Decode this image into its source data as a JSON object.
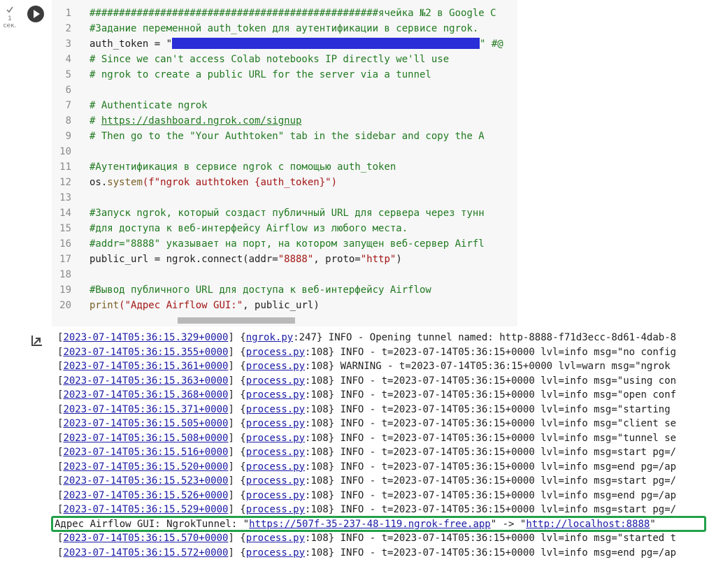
{
  "cell": {
    "exec_count": "1",
    "exec_unit": "сек.",
    "lines": [
      {
        "n": "1",
        "segments": [
          {
            "t": "#################################################ячейка №2 в Google C",
            "c": "comment"
          }
        ]
      },
      {
        "n": "2",
        "segments": [
          {
            "t": "#Задание переменной auth_token для аутентификации в сервисе ngrok.",
            "c": "comment"
          }
        ]
      },
      {
        "n": "3",
        "segments": [
          {
            "t": "auth_token = \"",
            "c": "plain"
          },
          {
            "t": "",
            "c": "redact"
          },
          {
            "t": "\" #@",
            "c": "comment"
          }
        ]
      },
      {
        "n": "4",
        "segments": [
          {
            "t": "# Since we can't access Colab notebooks IP directly we'll use",
            "c": "comment"
          }
        ]
      },
      {
        "n": "5",
        "segments": [
          {
            "t": "# ngrok to create a public URL for the server via a tunnel",
            "c": "comment"
          }
        ]
      },
      {
        "n": "6",
        "segments": []
      },
      {
        "n": "7",
        "segments": [
          {
            "t": "# Authenticate ngrok",
            "c": "comment"
          }
        ]
      },
      {
        "n": "8",
        "segments": [
          {
            "t": "# ",
            "c": "comment"
          },
          {
            "t": "https://dashboard.ngrok.com/signup",
            "c": "link"
          }
        ]
      },
      {
        "n": "9",
        "segments": [
          {
            "t": "# Then go to the \"Your Authtoken\" tab in the sidebar and copy the A",
            "c": "comment"
          }
        ]
      },
      {
        "n": "10",
        "segments": []
      },
      {
        "n": "11",
        "segments": [
          {
            "t": "#Аутентификация в сервисе ngrok с помощью auth_token",
            "c": "comment"
          }
        ]
      },
      {
        "n": "12",
        "segments": [
          {
            "t": "os.",
            "c": "plain"
          },
          {
            "t": "system",
            "c": "func"
          },
          {
            "t": "(f\"ngrok authtoken {auth_token}\")",
            "c": "str"
          }
        ]
      },
      {
        "n": "13",
        "segments": []
      },
      {
        "n": "14",
        "segments": [
          {
            "t": "#Запуск ngrok, который создаст публичный URL для сервера через тунн",
            "c": "comment"
          }
        ]
      },
      {
        "n": "15",
        "segments": [
          {
            "t": "#для доступа к веб-интерфейсу Airflow из любого места.",
            "c": "comment"
          }
        ]
      },
      {
        "n": "16",
        "segments": [
          {
            "t": "#addr=\"8888\" указывает на порт, на котором запущен веб-сервер Airfl",
            "c": "comment"
          }
        ]
      },
      {
        "n": "17",
        "segments": [
          {
            "t": "public_url = ngrok.connect(addr=",
            "c": "plain"
          },
          {
            "t": "\"8888\"",
            "c": "str"
          },
          {
            "t": ", proto=",
            "c": "plain"
          },
          {
            "t": "\"http\"",
            "c": "str"
          },
          {
            "t": ")",
            "c": "plain"
          }
        ]
      },
      {
        "n": "18",
        "segments": []
      },
      {
        "n": "19",
        "segments": [
          {
            "t": "#Вывод публичного URL для доступа к веб-интерфейсу Airflow",
            "c": "comment"
          }
        ]
      },
      {
        "n": "20",
        "segments": [
          {
            "t": "print",
            "c": "func"
          },
          {
            "t": "(\"Адрес Airflow GUI:\"",
            "c": "str"
          },
          {
            "t": ", public_url)",
            "c": "plain"
          }
        ]
      }
    ]
  },
  "output": {
    "lines": [
      {
        "ts": "2023-07-14T05:36:15.329+0000",
        "proc": "ngrok.py",
        "procnum": ":247",
        "rest": " INFO - Opening tunnel named: http-8888-f71d3ecc-8d61-4dab-8"
      },
      {
        "ts": "2023-07-14T05:36:15.355+0000",
        "proc": "process.py",
        "procnum": ":108",
        "rest": " INFO - t=2023-07-14T05:36:15+0000 lvl=info msg=\"no config"
      },
      {
        "ts": "2023-07-14T05:36:15.361+0000",
        "proc": "process.py",
        "procnum": ":108",
        "rest": " WARNING - t=2023-07-14T05:36:15+0000 lvl=warn msg=\"ngrok"
      },
      {
        "ts": "2023-07-14T05:36:15.363+0000",
        "proc": "process.py",
        "procnum": ":108",
        "rest": " INFO - t=2023-07-14T05:36:15+0000 lvl=info msg=\"using con"
      },
      {
        "ts": "2023-07-14T05:36:15.368+0000",
        "proc": "process.py",
        "procnum": ":108",
        "rest": " INFO - t=2023-07-14T05:36:15+0000 lvl=info msg=\"open conf"
      },
      {
        "ts": "2023-07-14T05:36:15.371+0000",
        "proc": "process.py",
        "procnum": ":108",
        "rest": " INFO - t=2023-07-14T05:36:15+0000 lvl=info msg=\"starting"
      },
      {
        "ts": "2023-07-14T05:36:15.505+0000",
        "proc": "process.py",
        "procnum": ":108",
        "rest": " INFO - t=2023-07-14T05:36:15+0000 lvl=info msg=\"client se"
      },
      {
        "ts": "2023-07-14T05:36:15.508+0000",
        "proc": "process.py",
        "procnum": ":108",
        "rest": " INFO - t=2023-07-14T05:36:15+0000 lvl=info msg=\"tunnel se"
      },
      {
        "ts": "2023-07-14T05:36:15.516+0000",
        "proc": "process.py",
        "procnum": ":108",
        "rest": " INFO - t=2023-07-14T05:36:15+0000 lvl=info msg=start pg=/"
      },
      {
        "ts": "2023-07-14T05:36:15.520+0000",
        "proc": "process.py",
        "procnum": ":108",
        "rest": " INFO - t=2023-07-14T05:36:15+0000 lvl=info msg=end pg=/ap"
      },
      {
        "ts": "2023-07-14T05:36:15.523+0000",
        "proc": "process.py",
        "procnum": ":108",
        "rest": " INFO - t=2023-07-14T05:36:15+0000 lvl=info msg=start pg=/"
      },
      {
        "ts": "2023-07-14T05:36:15.526+0000",
        "proc": "process.py",
        "procnum": ":108",
        "rest": " INFO - t=2023-07-14T05:36:15+0000 lvl=info msg=end pg=/ap"
      },
      {
        "ts": "2023-07-14T05:36:15.529+0000",
        "proc": "process.py",
        "procnum": ":108",
        "rest": " INFO - t=2023-07-14T05:36:15+0000 lvl=info msg=start pg=/"
      },
      {
        "airflow": true
      },
      {
        "ts": "2023-07-14T05:36:15.570+0000",
        "proc": "process.py",
        "procnum": ":108",
        "rest": " INFO - t=2023-07-14T05:36:15+0000 lvl=info msg=\"started t"
      },
      {
        "ts": "2023-07-14T05:36:15.572+0000",
        "proc": "process.py",
        "procnum": ":108",
        "rest": " INFO - t=2023-07-14T05:36:15+0000 lvl=info msg=end pg=/ap"
      }
    ],
    "airflow": {
      "prefix": "Адрес Airflow GUI: NgrokTunnel: \"",
      "public_url": "https://507f-35-237-48-119.ngrok-free.app",
      "middle": "\" -> \"",
      "local_url": "http://localhost:8888",
      "suffix": "\""
    }
  },
  "colors": {
    "highlight": "#22a14a",
    "redaction": "#2a2ed6",
    "comment": "#217a21",
    "link": "#1a1aa6"
  }
}
